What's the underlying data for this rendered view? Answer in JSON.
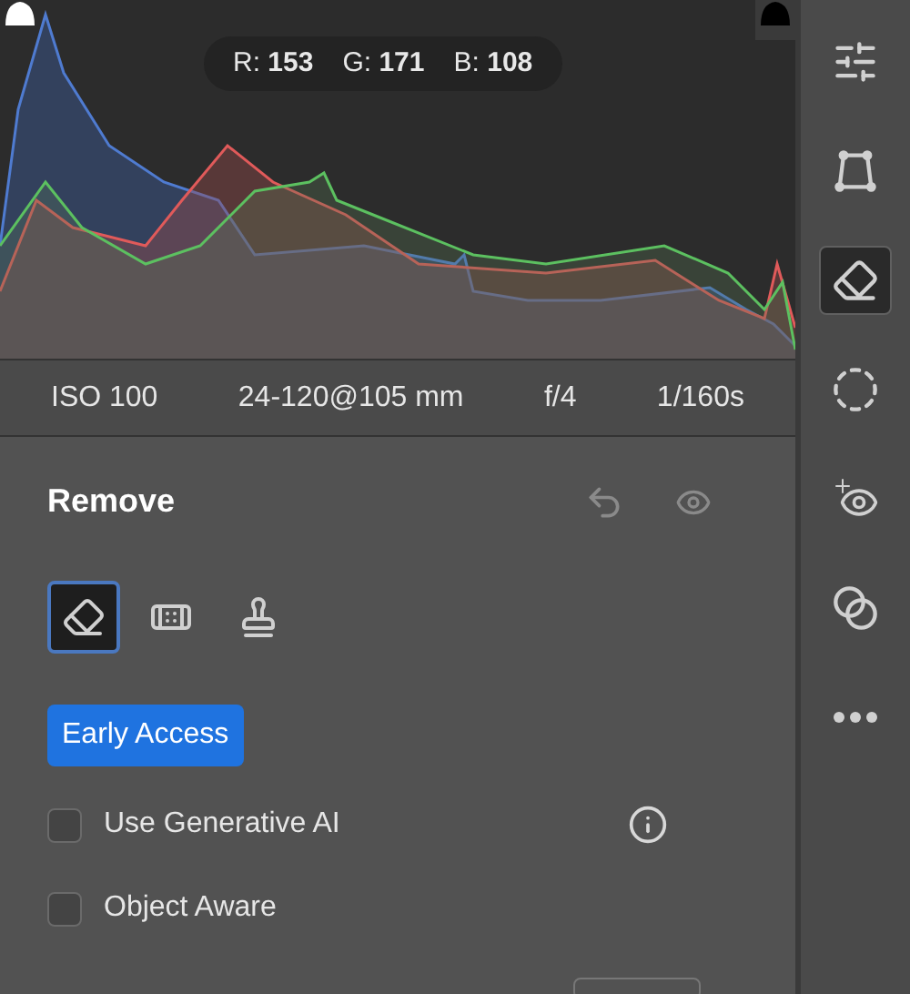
{
  "readout": [
    {
      "label": "R:",
      "value": "153"
    },
    {
      "label": "G:",
      "value": "171"
    },
    {
      "label": "B:",
      "value": "108"
    }
  ],
  "exif": [
    "ISO 100",
    "24-120@105 mm",
    "f/4",
    "1/160s"
  ],
  "panel": {
    "title": "Remove",
    "tools": [
      {
        "kind": "eraser",
        "selected": true
      },
      {
        "kind": "bandage",
        "selected": false
      },
      {
        "kind": "stamp",
        "selected": false
      }
    ],
    "badge": "Early Access",
    "options": [
      {
        "label": "Use Generative AI",
        "checked": false,
        "info": true
      },
      {
        "label": "Object Aware",
        "checked": false,
        "info": false
      }
    ]
  },
  "toolbar": [
    {
      "kind": "sliders",
      "selected": false
    },
    {
      "kind": "transform",
      "selected": false
    },
    {
      "kind": "eraser",
      "selected": true
    },
    {
      "kind": "selection",
      "selected": false
    },
    {
      "kind": "redeye",
      "selected": false
    },
    {
      "kind": "masks",
      "selected": false
    },
    {
      "kind": "more",
      "selected": false
    }
  ]
}
